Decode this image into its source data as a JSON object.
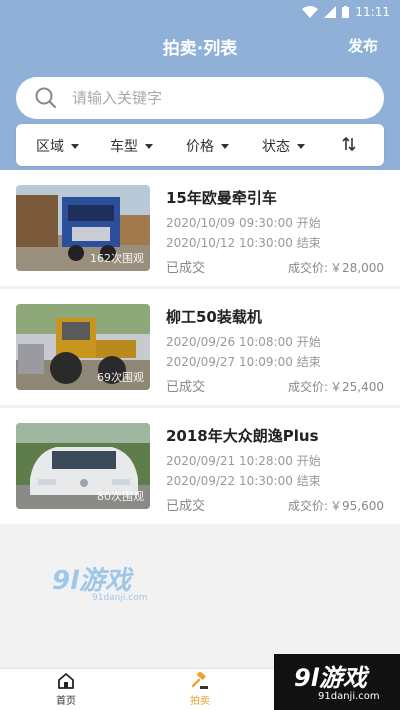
{
  "status_bar": {
    "time": "11:11"
  },
  "header": {
    "title": "拍卖·列表",
    "publish_label": "发布"
  },
  "search": {
    "placeholder": "请输入关键字"
  },
  "filters": [
    {
      "label": "区域"
    },
    {
      "label": "车型"
    },
    {
      "label": "价格"
    },
    {
      "label": "状态"
    }
  ],
  "items": [
    {
      "title": "15年欧曼牵引车",
      "start": "2020/10/09 09:30:00 开始",
      "end": "2020/10/12 10:30:00 结束",
      "status": "已成交",
      "price_label": "成交价:",
      "price": "￥28,000",
      "views": "162次围观"
    },
    {
      "title": "柳工50装载机",
      "start": "2020/09/26 10:08:00 开始",
      "end": "2020/09/27 10:09:00 结束",
      "status": "已成交",
      "price_label": "成交价:",
      "price": "￥25,400",
      "views": "69次围观"
    },
    {
      "title": "2018年大众朗逸Plus",
      "start": "2020/09/21 10:28:00 开始",
      "end": "2020/09/22 10:30:00 结束",
      "status": "已成交",
      "price_label": "成交价:",
      "price": "￥95,600",
      "views": "80次围观"
    }
  ],
  "bottom_nav": [
    {
      "label": "首页",
      "icon": "home-icon",
      "active": false
    },
    {
      "label": "拍卖",
      "icon": "gavel-icon",
      "active": true
    }
  ],
  "watermark": {
    "logo_text": "9l游戏",
    "site": "91danji.com"
  },
  "colors": {
    "header_bg": "#8fb1d8",
    "active_tab": "#f0a030",
    "page_bg": "#f2f2f2"
  }
}
